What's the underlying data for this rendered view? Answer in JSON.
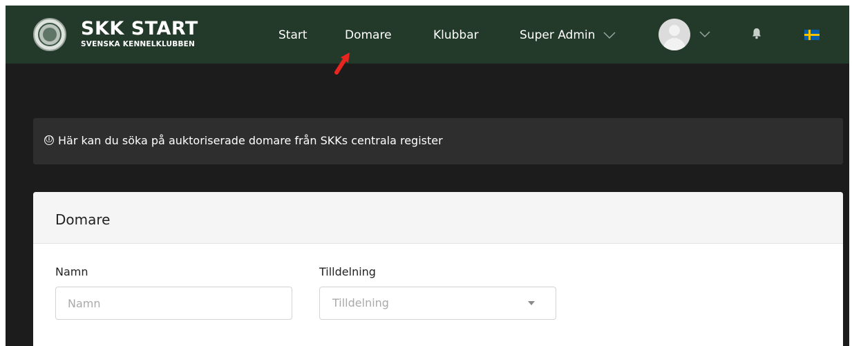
{
  "header": {
    "brand_title": "SKK START",
    "brand_subtitle": "SVENSKA KENNELKLUBBEN",
    "nav": {
      "start": "Start",
      "domare": "Domare",
      "klubbar": "Klubbar",
      "super_admin": "Super Admin"
    },
    "icons": [
      "logo-emblem",
      "chevron-down-icon",
      "avatar",
      "bell-icon",
      "swedish-flag-icon"
    ],
    "colors": {
      "navbar": "#233a2b",
      "page_bg": "#1c1c1c",
      "annotation_arrow": "#e8261f"
    }
  },
  "info": {
    "icon": "ⓘ",
    "text": "Här kan du söka på auktoriserade domare från SKKs centrala register"
  },
  "card": {
    "title": "Domare",
    "name_field": {
      "label": "Namn",
      "placeholder": "Namn",
      "value": ""
    },
    "allocation_field": {
      "label": "Tilldelning",
      "placeholder": "Tilldelning"
    }
  }
}
